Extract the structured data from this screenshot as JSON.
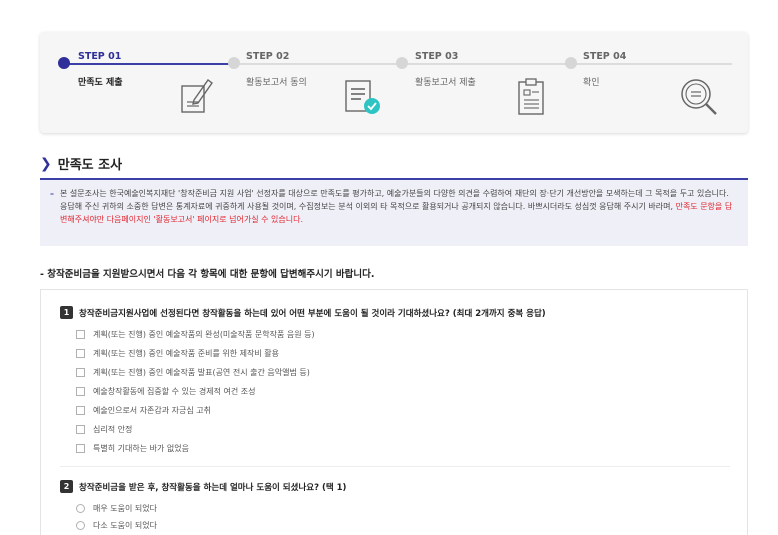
{
  "steps": [
    {
      "title": "STEP 01",
      "label": "만족도 제출",
      "icon": "document-edit-icon"
    },
    {
      "title": "STEP 02",
      "label": "활동보고서 동의",
      "icon": "document-check-icon"
    },
    {
      "title": "STEP 03",
      "label": "활동보고서 제출",
      "icon": "clipboard-icon"
    },
    {
      "title": "STEP 04",
      "label": "확인",
      "icon": "magnifier-icon"
    }
  ],
  "colors": {
    "accent": "#2f2f9a",
    "highlight": "#e0262f",
    "check": "#2fc4c4"
  },
  "section": {
    "title": "만족도 조사"
  },
  "notice": {
    "bullet": "–",
    "text_normal": "본 설문조사는 한국예술인복지재단 '창작준비금 지원 사업' 선정자를 대상으로 만족도를 평가하고, 예술가분들의 다양한 의견을 수렴하여 재단의 장·단기 개선방안을 모색하는데 그 목적을 두고 있습니다. 응답해 주신 귀하의 소중한 답변은 통계자료에 귀중하게 사용될 것이며, 수집정보는 분석 이외의 타 목적으로 활용되거나 공개되지 않습니다. 바쁘시더라도 성심껏 응답해 주시기 바라며, ",
    "text_red": "만족도 문항을 답변해주셔야만 다음페이지인 '활동보고서' 페이지로 넘어가실 수 있습니다."
  },
  "instruction": "- 창작준비금을 지원받으시면서 다음 각 항목에 대한 문항에 답변해주시기 바랍니다.",
  "q1": {
    "num": "1",
    "text": "창작준비금지원사업에 선정된다면 창작활동을 하는데 있어 어떤 부분에 도움이 될 것이라 기대하셨나요? (최대 2개까지 중복 응답)",
    "options": [
      "계획(또는 진행) 중인 예술작품의 완성(미술작품 문학작품 음원 등)",
      "계획(또는 진행) 중인 예술작품 준비를 위한 제작비 활용",
      "계획(또는 진행) 중인 예술작품 발표(공연 전시 출간 음악앨범 등)",
      "예술창작활동에 집중할 수 있는 경제적 여건 조성",
      "예술인으로서 자존감과 자긍심 고취",
      "심리적 안정",
      "특별히 기대하는 바가 없었음"
    ]
  },
  "q2": {
    "num": "2",
    "text": "창작준비금을 받은 후, 창작활동을 하는데 얼마나 도움이 되셨나요? (택 1)",
    "options": [
      "매우 도움이 되었다",
      "다소 도움이 되었다"
    ]
  }
}
